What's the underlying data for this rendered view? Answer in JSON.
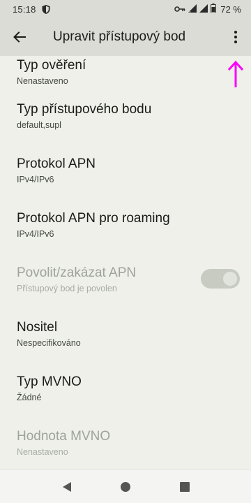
{
  "status_bar": {
    "time": "15:18",
    "battery_percent": "72 %"
  },
  "app_bar": {
    "title": "Upravit přístupový bod"
  },
  "settings": [
    {
      "title": "Typ ověření",
      "summary": "Nenastaveno",
      "enabled": true
    },
    {
      "title": "Typ přístupového bodu",
      "summary": "default,supl",
      "enabled": true
    },
    {
      "title": "Protokol APN",
      "summary": "IPv4/IPv6",
      "enabled": true
    },
    {
      "title": "Protokol APN pro roaming",
      "summary": "IPv4/IPv6",
      "enabled": true
    },
    {
      "title": "Povolit/zakázat APN",
      "summary": "Přístupový bod je povolen",
      "enabled": false,
      "toggle_on": true
    },
    {
      "title": "Nositel",
      "summary": "Nespecifikováno",
      "enabled": true
    },
    {
      "title": "Typ MVNO",
      "summary": "Žádné",
      "enabled": true
    },
    {
      "title": "Hodnota MVNO",
      "summary": "Nenastaveno",
      "enabled": false
    }
  ],
  "icons": {
    "back": "arrow-left-icon",
    "more": "more-vert-icon",
    "nav_back": "triangle-back-icon",
    "nav_home": "circle-home-icon",
    "nav_recents": "square-recents-icon"
  },
  "colors": {
    "background": "#eef0e9",
    "app_bar": "#dcdcd6",
    "annotation_arrow": "#ff00ff"
  }
}
